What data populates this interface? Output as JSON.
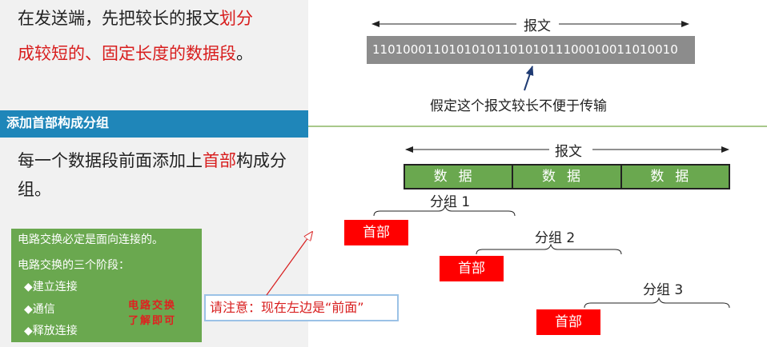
{
  "intro": {
    "line1_plain": "在发送端，先把较长的报文",
    "line1_red": "划分",
    "line2_red": "成较短的、固定长度的数据段",
    "line2_end": "。"
  },
  "section": {
    "title": "添加首部构成分组",
    "body_plain": "每一个数据段前面添加上",
    "body_red": "首部",
    "body_end": "构成分组。"
  },
  "note": {
    "line1": "电路交换必定是面向连接的。",
    "line2": "电路交换的三个阶段：",
    "bullets": [
      "◆建立连接",
      "◆通信",
      "◆释放连接"
    ],
    "stamp_line1": "电路交换",
    "stamp_line2": "了解即可"
  },
  "callout": "请注意：现在左边是“前面”",
  "message": {
    "label": "报文",
    "bits": "1101000110101010110101011100010011010010",
    "caption": "假定这个报文较长不便于传输"
  },
  "segments": {
    "label": "报文",
    "items": [
      "数据",
      "数据",
      "数据"
    ]
  },
  "packets": [
    {
      "label": "分组 1",
      "header": "首部"
    },
    {
      "label": "分组 2",
      "header": "首部"
    },
    {
      "label": "分组 3",
      "header": "首部"
    }
  ],
  "colors": {
    "accent_red": "#d81e1e",
    "section_blue": "#1f86b9",
    "green": "#6aa84f",
    "header_red": "#ff0000",
    "bar_gray": "#8c8c8c"
  }
}
